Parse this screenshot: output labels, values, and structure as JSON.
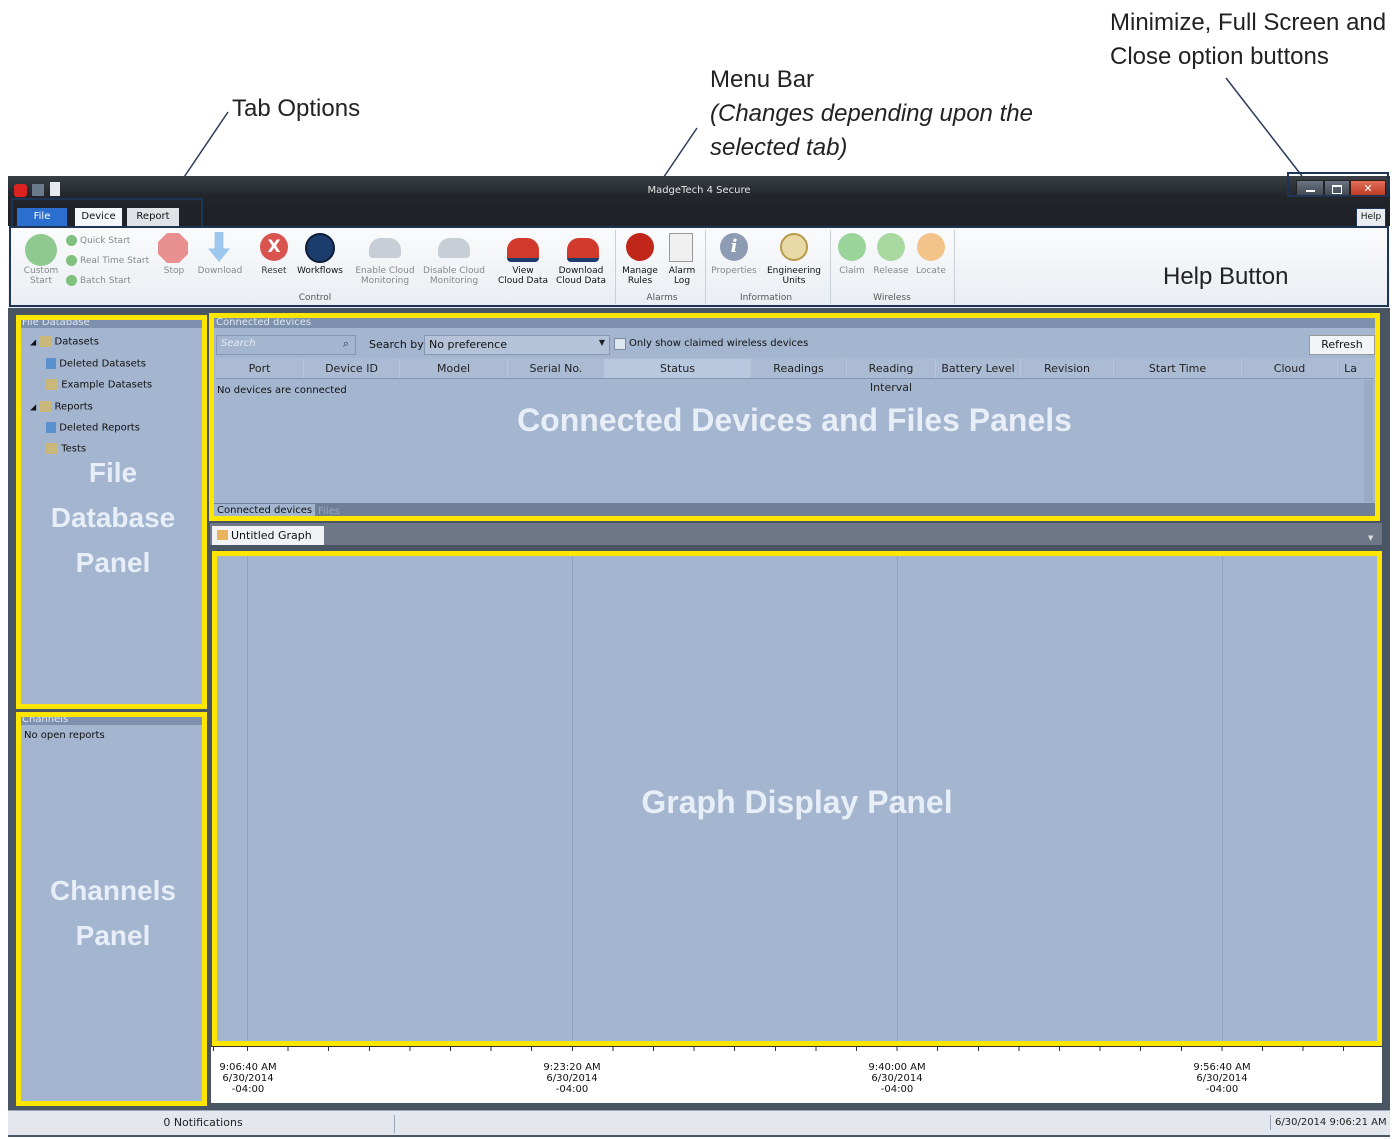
{
  "annotations": {
    "tab_options": "Tab Options",
    "menu_bar_line1": "Menu Bar",
    "menu_bar_line2": "(Changes depending upon the",
    "menu_bar_line3": "selected tab)",
    "window_buttons_line1": "Minimize, Full Screen and",
    "window_buttons_line2": "Close option buttons",
    "help_button": "Help Button",
    "file_db_panel_1": "File",
    "file_db_panel_2": "Database",
    "file_db_panel_3": "Panel",
    "connected_panel": "Connected Devices and Files Panels",
    "graph_panel": "Graph Display Panel",
    "channels_panel_1": "Channels",
    "channels_panel_2": "Panel"
  },
  "window": {
    "title": "MadgeTech 4 Secure"
  },
  "tabs": {
    "file": "File",
    "device": "Device",
    "report": "Report",
    "help": "Help"
  },
  "ribbon": {
    "custom_start_1": "Custom",
    "custom_start_2": "Start",
    "quick_start": "Quick Start",
    "real_time_start": "Real Time Start",
    "batch_start": "Batch Start",
    "stop": "Stop",
    "download": "Download",
    "reset": "Reset",
    "workflows": "Workflows",
    "enable_cloud_1": "Enable Cloud",
    "enable_cloud_2": "Monitoring",
    "disable_cloud_1": "Disable Cloud",
    "disable_cloud_2": "Monitoring",
    "view_cloud_1": "View",
    "view_cloud_2": "Cloud Data",
    "download_cloud_1": "Download",
    "download_cloud_2": "Cloud Data",
    "manage_rules_1": "Manage",
    "manage_rules_2": "Rules",
    "alarm_log_1": "Alarm",
    "alarm_log_2": "Log",
    "properties": "Properties",
    "engineering_units_1": "Engineering",
    "engineering_units_2": "Units",
    "claim": "Claim",
    "release": "Release",
    "locate": "Locate",
    "group_control": "Control",
    "group_alarms": "Alarms",
    "group_information": "Information",
    "group_wireless": "Wireless"
  },
  "file_database": {
    "header": "File Database",
    "items": [
      "Datasets",
      "Deleted Datasets",
      "Example Datasets",
      "Reports",
      "Deleted Reports",
      "Tests"
    ]
  },
  "channels": {
    "header": "Channels",
    "empty": "No open reports"
  },
  "connected": {
    "header": "Connected devices",
    "search_placeholder": "Search",
    "search_by_label": "Search by:",
    "search_by_value": "No preference",
    "only_claimed": "Only show claimed wireless devices",
    "refresh": "Refresh",
    "columns": [
      "Port",
      "Device ID",
      "Model",
      "Serial No.",
      "Status",
      "Readings",
      "Reading Interval",
      "Battery Level",
      "Revision",
      "Start Time",
      "Cloud",
      "La"
    ],
    "empty": "No devices are connected",
    "bottom_tab_devices": "Connected devices",
    "bottom_tab_files": "Files"
  },
  "graph": {
    "tab_title": "Untitled Graph",
    "ticks": [
      {
        "time": "9:06:40 AM",
        "date": "6/30/2014",
        "tz": "-04:00"
      },
      {
        "time": "9:23:20 AM",
        "date": "6/30/2014",
        "tz": "-04:00"
      },
      {
        "time": "9:40:00 AM",
        "date": "6/30/2014",
        "tz": "-04:00"
      },
      {
        "time": "9:56:40 AM",
        "date": "6/30/2014",
        "tz": "-04:00"
      }
    ]
  },
  "status": {
    "notifications": "0 Notifications",
    "datetime": "6/30/2014 9:06:21 AM"
  },
  "colors": {
    "highlight": "#ffe600",
    "panel": "#a3b5cf",
    "file_tab": "#2a6fcf"
  }
}
